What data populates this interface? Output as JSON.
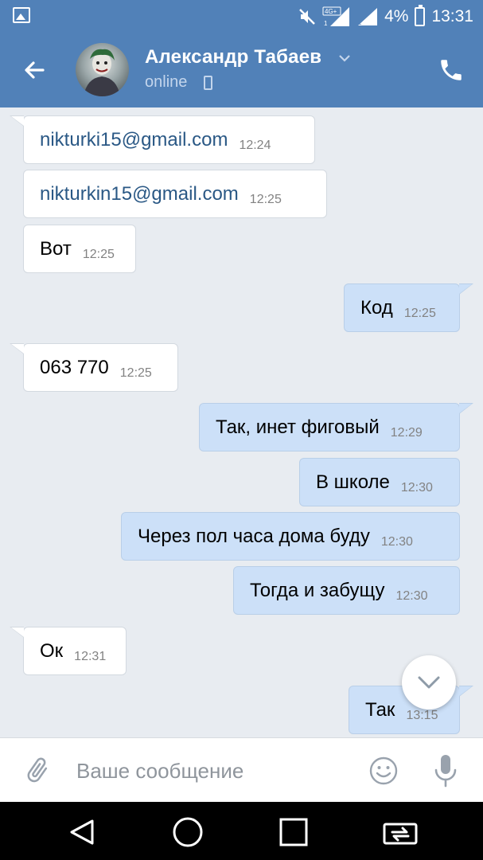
{
  "status_bar": {
    "network_label": "4G+",
    "battery": "4%",
    "time": "13:31"
  },
  "header": {
    "contact_name": "Александр Табаев",
    "status": "online"
  },
  "messages": [
    {
      "direction": "in",
      "text": "nikturki15@gmail.com",
      "time": "12:24",
      "is_link": true
    },
    {
      "direction": "in",
      "text": "nikturkin15@gmail.com",
      "time": "12:25",
      "is_link": true
    },
    {
      "direction": "in",
      "text": "Вот",
      "time": "12:25"
    },
    {
      "direction": "out",
      "text": "Код",
      "time": "12:25"
    },
    {
      "direction": "in",
      "text": "063 770",
      "time": "12:25"
    },
    {
      "direction": "out",
      "text": "Так, инет фиговый",
      "time": "12:29"
    },
    {
      "direction": "out",
      "text": "В школе",
      "time": "12:30"
    },
    {
      "direction": "out",
      "text": "Через пол часа дома буду",
      "time": "12:30"
    },
    {
      "direction": "out",
      "text": "Тогда и забущу",
      "time": "12:30"
    },
    {
      "direction": "in",
      "text": "Ок",
      "time": "12:31"
    },
    {
      "direction": "out",
      "text": "Так",
      "time": "13:15"
    }
  ],
  "composer": {
    "placeholder": "Ваше сообщение",
    "value": ""
  },
  "colors": {
    "header_bg": "#5181b8",
    "incoming_bubble": "#ffffff",
    "outgoing_bubble": "#cce0f8",
    "chat_bg": "#e8ecf1",
    "link": "#2a5885"
  },
  "icons": {
    "status_left": "image-notification-icon",
    "mute": "muted-speaker-icon",
    "signal": "signal-strength-icon",
    "battery": "battery-icon",
    "back": "arrow-left-icon",
    "call": "phone-icon",
    "attach": "paperclip-icon",
    "emoji": "smiley-icon",
    "mic": "microphone-icon",
    "scroll": "chevron-down-icon"
  }
}
